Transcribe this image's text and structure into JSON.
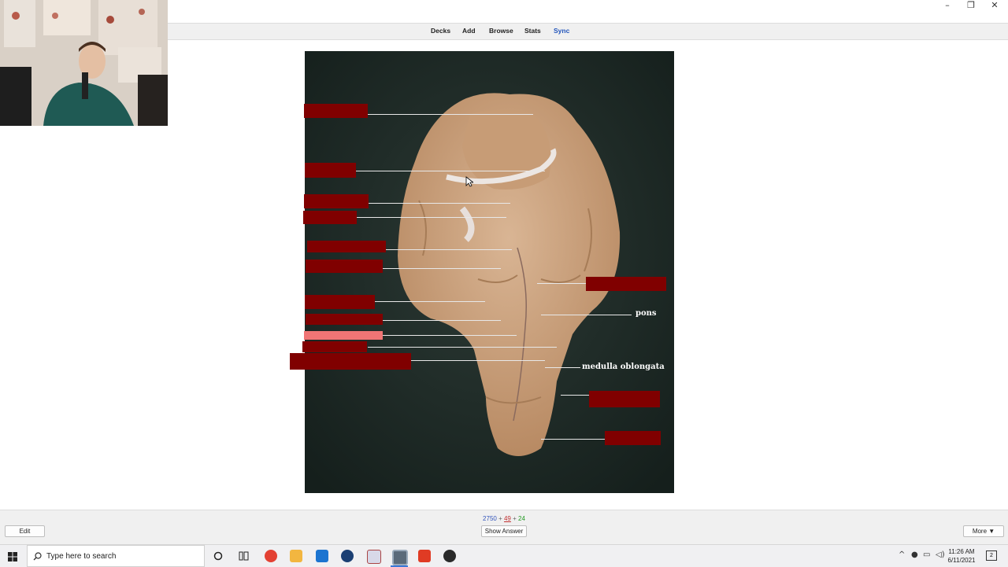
{
  "toolbar": {
    "decks": "Decks",
    "add": "Add",
    "browse": "Browse",
    "stats": "Stats",
    "sync": "Sync"
  },
  "window_controls": {
    "minimize": "–",
    "restore": "❐",
    "close": "✕"
  },
  "card": {
    "labels": {
      "pons": "pons",
      "medulla": "medulla oblongata"
    }
  },
  "bottom": {
    "edit_label": "Edit",
    "show_answer_label": "Show Answer",
    "more_label": "More ▼",
    "counts": {
      "new": "2750",
      "learn": "49",
      "review": "24",
      "plus": "+"
    }
  },
  "taskbar": {
    "search_placeholder": "Type here to search",
    "time": "11:26 AM",
    "date": "6/11/2021",
    "notification_count": "2"
  },
  "colors": {
    "occlusion_box": "#800000",
    "occlusion_active": "#f07575",
    "sync_link": "#2255bb"
  }
}
